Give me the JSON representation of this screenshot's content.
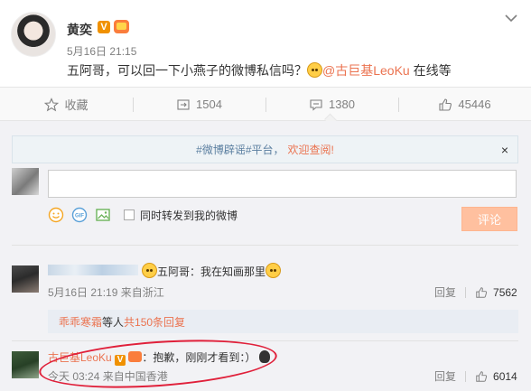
{
  "post": {
    "author": "黄奕",
    "v_badge": "V",
    "time": "5月16日 21:15",
    "text_before": "五阿哥，可以回一下小燕子的微博私信吗？",
    "mention": "@古巨基LeoKu",
    "text_after": " 在线等"
  },
  "actions": [
    {
      "label": "收藏",
      "icon": "star-icon"
    },
    {
      "label": "1504",
      "icon": "repost-icon"
    },
    {
      "label": "1380",
      "icon": "comment-icon"
    },
    {
      "label": "45446",
      "icon": "like-icon"
    }
  ],
  "notice": {
    "hashtag": "#微博辟谣#平台，",
    "link": "欢迎查阅!",
    "close": "×"
  },
  "composer": {
    "sync_label": "同时转发到我的微博",
    "submit_label": "评论"
  },
  "comments": [
    {
      "text": "五阿哥：我在知画那里",
      "meta": "5月16日 21:19 来自浙江",
      "reply_label": "回复",
      "likes": "7562"
    },
    {
      "author": "古巨基LeoKu",
      "v_badge": "V",
      "text": "：抱歉，刚刚才看到：）",
      "meta": "今天 03:24 来自中国香港",
      "reply_label": "回复",
      "likes": "6014"
    }
  ],
  "reply_summary": {
    "user": "乖乖寒霜",
    "middle": " 等人 ",
    "count_link": "共150条回复"
  },
  "colors": {
    "accent": "#eb7350",
    "link": "#eb7350",
    "annotation": "#e0203a"
  }
}
